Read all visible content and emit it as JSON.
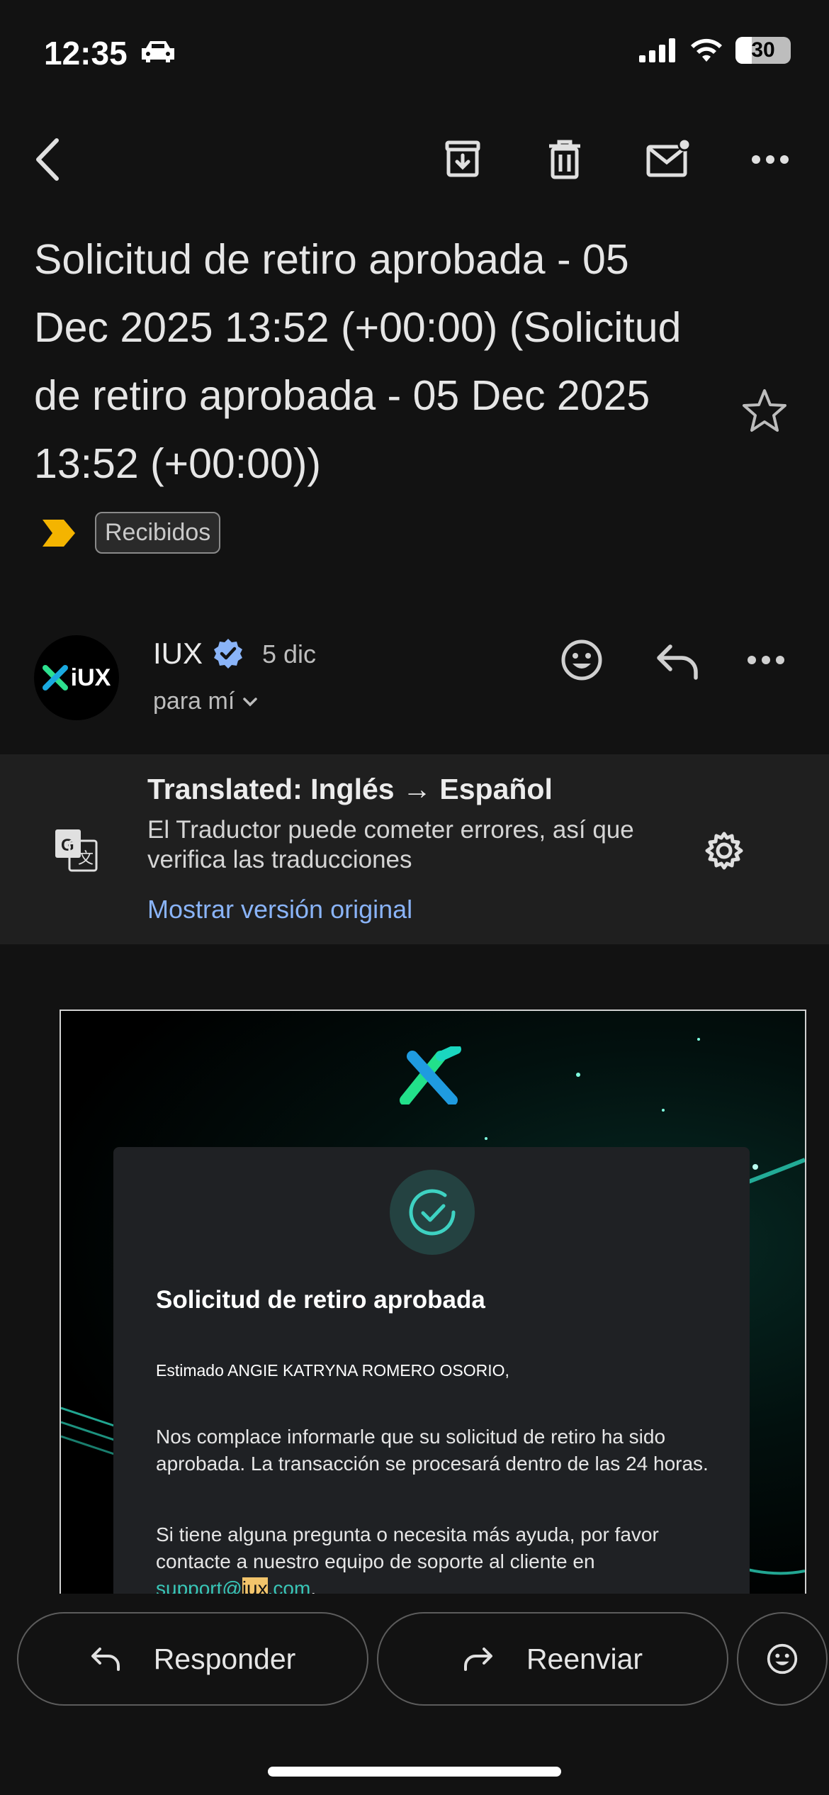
{
  "status_bar": {
    "time": "12:35",
    "battery_percent": "30",
    "battery_level": 0.3,
    "icons": [
      "car-icon",
      "signal-icon",
      "wifi-icon",
      "battery-icon"
    ]
  },
  "toolbar": {
    "icons": [
      "back-icon",
      "archive-icon",
      "delete-icon",
      "mark-unread-icon",
      "more-icon"
    ]
  },
  "email": {
    "subject": "Solicitud de retiro aprobada - 05 Dec 2025 13:52 (+00:00) (Solicitud de retiro aprobada - 05 Dec 2025 13:52 (+00:00))",
    "label": "Recibidos",
    "sender": {
      "avatar_text": "iUX",
      "name": "IUX",
      "date": "5 dic",
      "recipient": "para mí"
    }
  },
  "translation": {
    "title": "Translated: Inglés → Español",
    "note": "El Traductor puede cometer errores, así que verifica las traducciones",
    "link": "Mostrar versión original"
  },
  "content": {
    "title": "Solicitud de retiro aprobada",
    "greeting": "Estimado ANGIE KATRYNA ROMERO OSORIO,",
    "paragraph1": "Nos complace informarle que su solicitud de retiro ha sido aprobada. La transacción se procesará dentro de las 24 horas.",
    "paragraph2": "Si tiene alguna pregunta o necesita más ayuda, por favor contacte a nuestro equipo de soporte al cliente en",
    "support_user": "support@",
    "support_domain_highlight": "iux",
    "support_tld": ".com",
    "support_end": "."
  },
  "actions": {
    "reply_label": "Responder",
    "forward_label": "Reenviar"
  },
  "colors": {
    "background": "#121212",
    "link": "#8ab4f8",
    "accent_teal": "#39c6b7",
    "important_marker": "#f4b400",
    "verified_badge": "#8ab4f8"
  }
}
